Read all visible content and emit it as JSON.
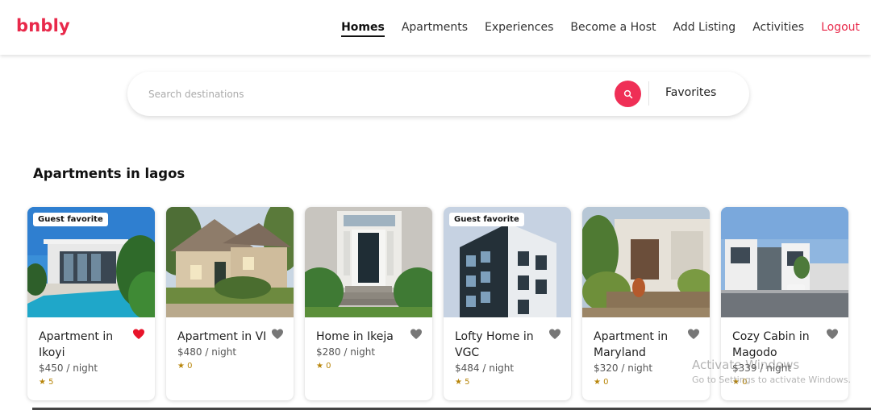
{
  "brand": {
    "logo": "bnbly",
    "accent": "#e8294a"
  },
  "nav": {
    "items": [
      {
        "label": "Homes",
        "active": true
      },
      {
        "label": "Apartments",
        "active": false
      },
      {
        "label": "Experiences",
        "active": false
      },
      {
        "label": "Become a Host",
        "active": false
      },
      {
        "label": "Add Listing",
        "active": false
      },
      {
        "label": "Activities",
        "active": false
      }
    ],
    "logout": "Logout"
  },
  "search": {
    "placeholder": "Search destinations",
    "value": "",
    "icon": "search-icon",
    "favorites": "Favorites"
  },
  "section": {
    "title": "Apartments in lagos"
  },
  "listings": [
    {
      "title": "Apartment in Ikoyi",
      "price": "$450 / night",
      "rating": "★ 5",
      "badge": "Guest favorite",
      "favorited": true,
      "image": "modern-villa-pool"
    },
    {
      "title": "Apartment in VI",
      "price": "$480 / night",
      "rating": "★ 0",
      "badge": "",
      "favorited": false,
      "image": "suburban-house"
    },
    {
      "title": "Home in Ikeja",
      "price": "$280 / night",
      "rating": "★ 0",
      "badge": "",
      "favorited": false,
      "image": "front-door-steps"
    },
    {
      "title": "Lofty Home in VGC",
      "price": "$484 / night",
      "rating": "★ 5",
      "badge": "Guest favorite",
      "favorited": false,
      "image": "modern-tower"
    },
    {
      "title": "Apartment in Maryland",
      "price": "$320 / night",
      "rating": "★ 0",
      "badge": "",
      "favorited": false,
      "image": "stone-house-garden"
    },
    {
      "title": "Cozy Cabin in Magodo",
      "price": "$339 / night",
      "rating": "★ 0",
      "badge": "",
      "favorited": false,
      "image": "modern-street"
    }
  ],
  "watermark": {
    "line1": "Activate Windows",
    "line2": "Go to Settings to activate Windows."
  }
}
